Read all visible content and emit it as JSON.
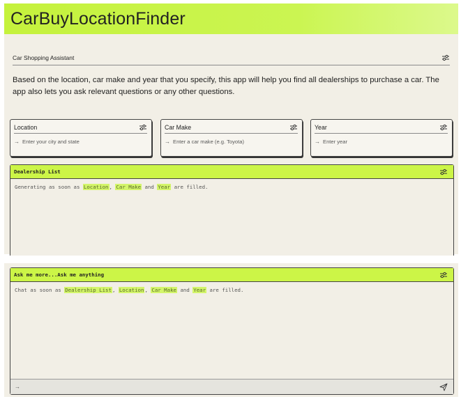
{
  "app": {
    "title": "CarBuyLocationFinder"
  },
  "assistant": {
    "label": "Car Shopping Assistant",
    "description": "Based on the location, car make and year that you specify, this app will help you find all dealerships to purchase a car. The app also lets you ask relevant questions or any other questions."
  },
  "inputs": [
    {
      "label": "Location",
      "placeholder": "Enter your city and state"
    },
    {
      "label": "Car Make",
      "placeholder": "Enter a car make (e.g. Toyota)"
    },
    {
      "label": "Year",
      "placeholder": "Enter year"
    }
  ],
  "dealership": {
    "title": "Dealership List",
    "status_prefix": "Generating as soon as",
    "sep1": ",",
    "and": "and",
    "suffix": "are filled.",
    "fields": [
      "Location",
      "Car Make",
      "Year"
    ]
  },
  "chat": {
    "title": "Ask me more...Ask me anything",
    "status_prefix": "Chat as soon as",
    "sep": ",",
    "and": "and",
    "suffix": "are filled.",
    "fields": [
      "Dealership List",
      "Location",
      "Car Make",
      "Year"
    ],
    "input_arrow": "→"
  },
  "icons": {
    "settings": "sliders-icon",
    "arrow": "arrow-right-icon",
    "send": "send-icon"
  },
  "colors": {
    "accent": "#ccf547",
    "highlight": "#d3f56a",
    "panel_bg": "#f2efe6"
  }
}
